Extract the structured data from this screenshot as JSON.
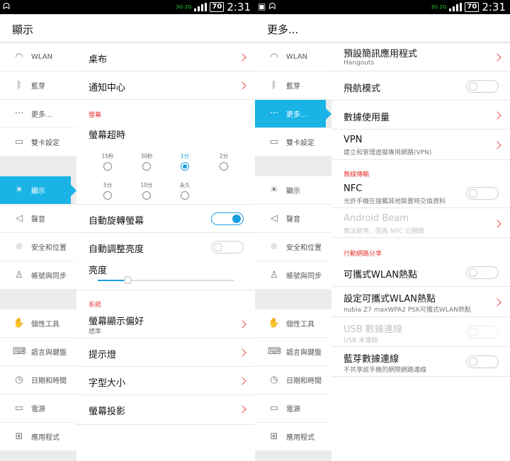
{
  "status_bar": {
    "network": "3G 2G",
    "battery": "70",
    "time": "2:31"
  },
  "left": {
    "title": "顯示",
    "nav": [
      {
        "label": "WLAN",
        "icon": "wifi-icon"
      },
      {
        "label": "藍芽",
        "icon": "bluetooth-icon"
      },
      {
        "label": "更多...",
        "icon": "more-dots-icon"
      },
      {
        "label": "雙卡設定",
        "icon": "sim-card-icon"
      },
      {
        "label": "顯示",
        "icon": "brightness-icon",
        "active": true
      },
      {
        "label": "聲音",
        "icon": "speaker-icon"
      },
      {
        "label": "安全和位置",
        "icon": "location-pin-icon"
      },
      {
        "label": "帳號與同步",
        "icon": "person-icon"
      },
      {
        "label": "個性工具",
        "icon": "hand-icon"
      },
      {
        "label": "語言與鍵盤",
        "icon": "keyboard-icon"
      },
      {
        "label": "日期和時間",
        "icon": "clock-icon"
      },
      {
        "label": "電源",
        "icon": "battery-icon"
      },
      {
        "label": "應用程式",
        "icon": "apps-grid-icon"
      }
    ],
    "rows": {
      "wallpaper": "桌布",
      "notification_center": "通知中心",
      "section_screen": "螢幕",
      "screen_timeout": "螢幕超時",
      "timeout_options": [
        "15秒",
        "30秒",
        "1分",
        "2分",
        "5分",
        "10分",
        "永久"
      ],
      "timeout_selected": "1分",
      "auto_rotate": "自動旋轉螢幕",
      "auto_rotate_on": true,
      "auto_brightness": "自動調整亮度",
      "auto_brightness_on": false,
      "brightness": "亮度",
      "brightness_level": 0.22,
      "section_system": "系統",
      "display_pref": "螢幕顯示偏好",
      "display_pref_value": "標準",
      "indicator_light": "提示燈",
      "font_size": "字型大小",
      "screen_cast": "螢幕投影"
    }
  },
  "right": {
    "title": "更多...",
    "nav_active": "更多...",
    "rows": {
      "default_sms": "預設簡訊應用程式",
      "default_sms_value": "Hangouts",
      "airplane": "飛航模式",
      "data_usage": "數據使用量",
      "vpn": "VPN",
      "vpn_sub": "建立和管理虛擬專用網路(VPN)",
      "section_wireless": "無線傳輸",
      "nfc": "NFC",
      "nfc_sub": "允許手機在接觸其他裝置時交換資料",
      "android_beam": "Android Beam",
      "android_beam_sub": "無法使用，因為 NFC 已關閉",
      "section_tethering": "行動網路分享",
      "hotspot": "可攜式WLAN熱點",
      "hotspot_setup": "設定可攜式WLAN熱點",
      "hotspot_setup_sub": "nubia Z7 maxWPA2 PSK可攜式WLAN熱點",
      "usb_tether": "USB 數據連線",
      "usb_tether_sub": "USB 未連線",
      "bt_tether": "藍芽數據連線",
      "bt_tether_sub": "不共享該手機的網際網路連線"
    }
  }
}
